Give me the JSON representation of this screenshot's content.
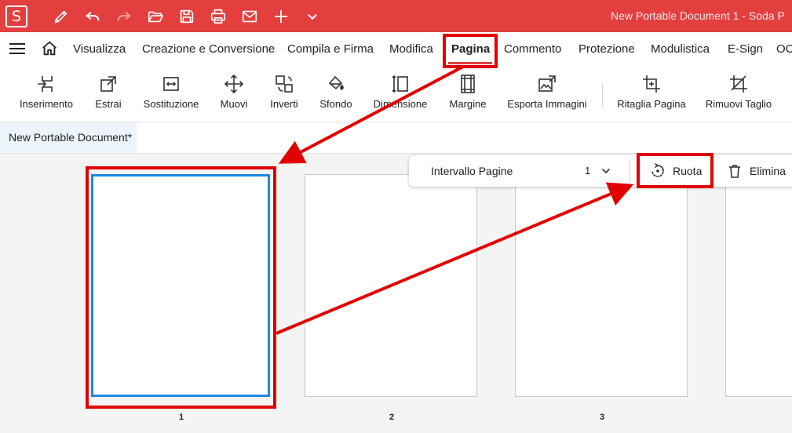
{
  "app": {
    "logo_letter": "S",
    "window_title": "New Portable Document 1  -  Soda P",
    "accent_color": "#e43f3f",
    "selection_color": "#1e88e5",
    "annotation_color": "#e00000"
  },
  "quick_access": [
    "pen-icon",
    "undo-icon",
    "redo-icon",
    "open-folder-icon",
    "save-icon",
    "print-icon",
    "mail-icon",
    "plus-icon",
    "chevron-down-icon"
  ],
  "menu": {
    "items": [
      "Visualizza",
      "Creazione e Conversione",
      "Compila e Firma",
      "Modifica",
      "Pagina",
      "Commento",
      "Protezione",
      "Modulistica",
      "E-Sign",
      "OC"
    ],
    "active": "Pagina"
  },
  "ribbon": {
    "buttons": [
      "Inserimento",
      "Estrai",
      "Sostituzione",
      "Muovi",
      "Inverti",
      "Sfondo",
      "Dimensione",
      "Margine",
      "Esporta Immagini",
      "Ritaglia Pagina",
      "Rimuovi Taglio"
    ]
  },
  "document_tab": {
    "label": "New Portable Document*"
  },
  "page_toolbar": {
    "range_label": "Intervallo Pagine",
    "range_value": "1",
    "rotate_label": "Ruota",
    "delete_label": "Elimina"
  },
  "pages": [
    {
      "number": "1",
      "selected": true
    },
    {
      "number": "2",
      "selected": false
    },
    {
      "number": "3",
      "selected": false
    }
  ]
}
